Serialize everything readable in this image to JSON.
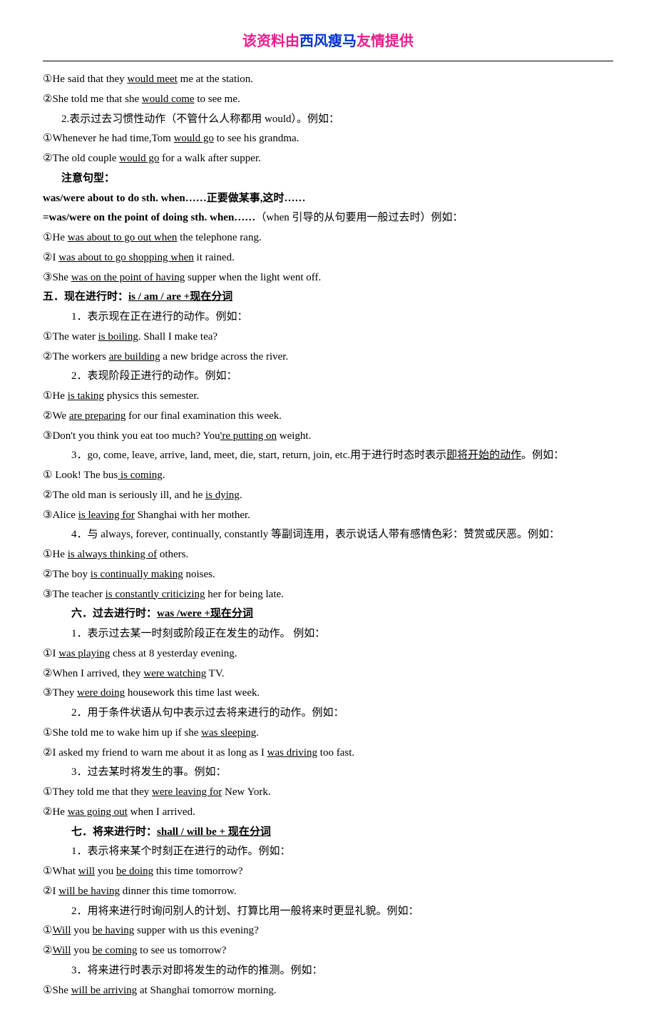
{
  "header": {
    "part1": "该资料由",
    "part2": "西风瘦马",
    "part3": "友情提供"
  },
  "lines": [
    {
      "cls": "line",
      "segs": [
        {
          "t": "①He said that they "
        },
        {
          "t": "would meet",
          "u": true
        },
        {
          "t": " me at the station."
        }
      ]
    },
    {
      "cls": "line",
      "segs": [
        {
          "t": "②She told me that she "
        },
        {
          "t": "would come",
          "u": true
        },
        {
          "t": " to see me."
        }
      ]
    },
    {
      "cls": "line indent1",
      "segs": [
        {
          "t": "2.表示过去习惯性动作（不管什么人称都用 would）。例如："
        }
      ]
    },
    {
      "cls": "line",
      "segs": [
        {
          "t": "①Whenever he had time,Tom "
        },
        {
          "t": "would go",
          "u": true
        },
        {
          "t": " to see his grandma."
        }
      ]
    },
    {
      "cls": "line",
      "segs": [
        {
          "t": "②The old couple "
        },
        {
          "t": "would go",
          "u": true
        },
        {
          "t": " for a walk after supper."
        }
      ]
    },
    {
      "cls": "line indent1 bold",
      "segs": [
        {
          "t": "注意句型："
        }
      ]
    },
    {
      "cls": "line bold",
      "segs": [
        {
          "t": "was/were about to do sth. when……正要做某事,这时……"
        }
      ]
    },
    {
      "cls": "line",
      "segs": [
        {
          "t": "=was/were on the point of doing sth. when……",
          "b": true
        },
        {
          "t": "（when 引导的从句要用一般过去时）例如："
        }
      ]
    },
    {
      "cls": "line",
      "segs": [
        {
          "t": "①He "
        },
        {
          "t": "was about to go out when",
          "u": true
        },
        {
          "t": " the telephone rang."
        }
      ]
    },
    {
      "cls": "line",
      "segs": [
        {
          "t": "②I "
        },
        {
          "t": "was about to go shopping when",
          "u": true
        },
        {
          "t": " it rained."
        }
      ]
    },
    {
      "cls": "line",
      "segs": [
        {
          "t": "③She "
        },
        {
          "t": "was on the point of having",
          "u": true
        },
        {
          "t": " supper when the light went off."
        }
      ]
    },
    {
      "cls": "line bold",
      "segs": [
        {
          "t": "五．现在进行时："
        },
        {
          "t": "is / am / are +现在分词",
          "u": true
        }
      ]
    },
    {
      "cls": "line indent2",
      "segs": [
        {
          "t": "1．表示现在正在进行的动作。例如："
        }
      ]
    },
    {
      "cls": "line",
      "segs": [
        {
          "t": "①The water "
        },
        {
          "t": "is boiling",
          "u": true
        },
        {
          "t": ". Shall I make tea?"
        }
      ]
    },
    {
      "cls": "line",
      "segs": [
        {
          "t": "②The workers "
        },
        {
          "t": "are building",
          "u": true
        },
        {
          "t": " a new bridge across the river."
        }
      ]
    },
    {
      "cls": "line indent2",
      "segs": [
        {
          "t": "2．表现阶段正进行的动作。例如："
        }
      ]
    },
    {
      "cls": "line",
      "segs": [
        {
          "t": "①He "
        },
        {
          "t": "is taking",
          "u": true
        },
        {
          "t": " physics this semester."
        }
      ]
    },
    {
      "cls": "line",
      "segs": [
        {
          "t": "②We "
        },
        {
          "t": "are preparing",
          "u": true
        },
        {
          "t": " for our final examination this week."
        }
      ]
    },
    {
      "cls": "line",
      "segs": [
        {
          "t": "③Don't you think you eat too much? You"
        },
        {
          "t": "'re putting on",
          "u": true
        },
        {
          "t": " weight."
        }
      ]
    },
    {
      "cls": "line indent2",
      "segs": [
        {
          "t": "3．go, come, leave, arrive, land, meet, die, start, return, join, etc.用于进行时态时表示"
        },
        {
          "t": "即将开始的动作",
          "u": true
        },
        {
          "t": "。例如："
        }
      ]
    },
    {
      "cls": "line",
      "segs": [
        {
          "t": "①  Look! The bus"
        },
        {
          "t": " is coming",
          "u": true
        },
        {
          "t": "."
        }
      ]
    },
    {
      "cls": "line",
      "segs": [
        {
          "t": "②The old man is seriously ill, and he "
        },
        {
          "t": "is dying",
          "u": true
        },
        {
          "t": "."
        }
      ]
    },
    {
      "cls": "line",
      "segs": [
        {
          "t": "③Alice "
        },
        {
          "t": "is leaving for",
          "u": true
        },
        {
          "t": " Shanghai with her mother."
        }
      ]
    },
    {
      "cls": "line indent2",
      "segs": [
        {
          "t": "4．与 always, forever, continually, constantly 等副词连用，表示说话人带有感情色彩：赞赏或厌恶。例如："
        }
      ]
    },
    {
      "cls": "line",
      "segs": [
        {
          "t": "①He "
        },
        {
          "t": "is always thinking of",
          "u": true
        },
        {
          "t": " others."
        }
      ]
    },
    {
      "cls": "line",
      "segs": [
        {
          "t": "②The boy "
        },
        {
          "t": "is continually making",
          "u": true
        },
        {
          "t": " noises."
        }
      ]
    },
    {
      "cls": "line",
      "segs": [
        {
          "t": "③The teacher "
        },
        {
          "t": "is constantly criticizing",
          "u": true
        },
        {
          "t": " her for being late."
        }
      ]
    },
    {
      "cls": "line indent2 bold",
      "segs": [
        {
          "t": "六．过去进行时："
        },
        {
          "t": "was /were +现在分词",
          "u": true
        }
      ]
    },
    {
      "cls": "line indent2",
      "segs": [
        {
          "t": "1．表示过去某一时刻或阶段正在发生的动作。 例如："
        }
      ]
    },
    {
      "cls": "line",
      "segs": [
        {
          "t": "①I "
        },
        {
          "t": "was playing",
          "u": true
        },
        {
          "t": " chess at 8 yesterday evening."
        }
      ]
    },
    {
      "cls": "line",
      "segs": [
        {
          "t": "②When I arrived, they "
        },
        {
          "t": "were watching",
          "u": true
        },
        {
          "t": " TV."
        }
      ]
    },
    {
      "cls": "line",
      "segs": [
        {
          "t": "③They "
        },
        {
          "t": "were doing",
          "u": true
        },
        {
          "t": " housework this time last week."
        }
      ]
    },
    {
      "cls": "line indent2",
      "segs": [
        {
          "t": "2．用于条件状语从句中表示过去将来进行的动作。例如："
        }
      ]
    },
    {
      "cls": "line",
      "segs": [
        {
          "t": "①She told me to wake him up if she "
        },
        {
          "t": "was sleeping",
          "u": true
        },
        {
          "t": "."
        }
      ]
    },
    {
      "cls": "line",
      "segs": [
        {
          "t": "②I asked my friend to warn me about it as long as I "
        },
        {
          "t": "was driving",
          "u": true
        },
        {
          "t": " too fast."
        }
      ]
    },
    {
      "cls": "line indent2",
      "segs": [
        {
          "t": "3．过去某时将发生的事。例如："
        }
      ]
    },
    {
      "cls": "line",
      "segs": [
        {
          "t": "①They told me that they "
        },
        {
          "t": "were leaving for",
          "u": true
        },
        {
          "t": " New York."
        }
      ]
    },
    {
      "cls": "line",
      "segs": [
        {
          "t": "②He "
        },
        {
          "t": "was going out",
          "u": true
        },
        {
          "t": " when I arrived."
        }
      ]
    },
    {
      "cls": "line indent2 bold",
      "segs": [
        {
          "t": "七．将来进行时："
        },
        {
          "t": "shall / will be +  现在分词",
          "u": true
        }
      ]
    },
    {
      "cls": "line indent2",
      "segs": [
        {
          "t": "1．表示将来某个时刻正在进行的动作。例如："
        }
      ]
    },
    {
      "cls": "line",
      "segs": [
        {
          "t": "①What "
        },
        {
          "t": "will",
          "u": true
        },
        {
          "t": " you "
        },
        {
          "t": "be doing",
          "u": true
        },
        {
          "t": " this time tomorrow?"
        }
      ]
    },
    {
      "cls": "line",
      "segs": [
        {
          "t": "②I "
        },
        {
          "t": "will be having",
          "u": true
        },
        {
          "t": " dinner this time tomorrow."
        }
      ]
    },
    {
      "cls": "line indent2",
      "segs": [
        {
          "t": "2．用将来进行时询问别人的计划、打算比用一般将来时更显礼貌。例如："
        }
      ]
    },
    {
      "cls": "line",
      "segs": [
        {
          "t": "①"
        },
        {
          "t": "Will",
          "u": true
        },
        {
          "t": " you "
        },
        {
          "t": "be having",
          "u": true
        },
        {
          "t": " supper with us this evening?"
        }
      ]
    },
    {
      "cls": "line",
      "segs": [
        {
          "t": "②"
        },
        {
          "t": "Will",
          "u": true
        },
        {
          "t": " you "
        },
        {
          "t": "be coming",
          "u": true
        },
        {
          "t": " to see us tomorrow?"
        }
      ]
    },
    {
      "cls": "line indent2",
      "segs": [
        {
          "t": "3．将来进行时表示对即将发生的动作的推测。例如："
        }
      ]
    },
    {
      "cls": "line",
      "segs": [
        {
          "t": "①She "
        },
        {
          "t": "will be arriving",
          "u": true
        },
        {
          "t": " at Shanghai tomorrow morning."
        }
      ]
    }
  ]
}
